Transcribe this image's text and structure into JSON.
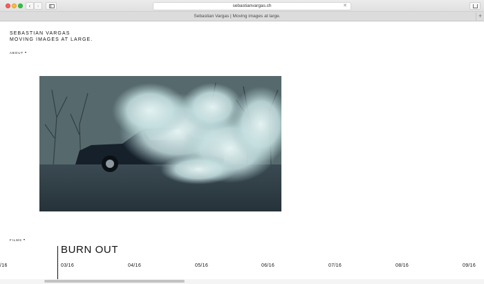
{
  "browser": {
    "url": "sebastianvargas.ch",
    "tab_title": "Sebastian Vargas | Moving images at large.",
    "new_tab_label": "+",
    "back_label": "‹",
    "forward_label": "›",
    "clear_label": "✕"
  },
  "site": {
    "name": "SEBASTIAN VARGAS",
    "tagline": "MOVING IMAGES AT LARGE.",
    "about_label": "ABOUT",
    "films_label": "FILMS"
  },
  "hero": {
    "icon": "film-still-image",
    "subject": "car in smoke"
  },
  "timeline": {
    "current_film": "BURN OUT",
    "months": [
      "/16",
      "03/16",
      "04/16",
      "05/16",
      "06/16",
      "07/16",
      "08/16",
      "09/16"
    ]
  },
  "colors": {
    "chrome": "#e6e6e6",
    "tabbar": "#dcdcdc",
    "text": "#111111",
    "close": "#fc5f57",
    "minimize": "#fdbc2e",
    "zoom": "#28c840"
  }
}
